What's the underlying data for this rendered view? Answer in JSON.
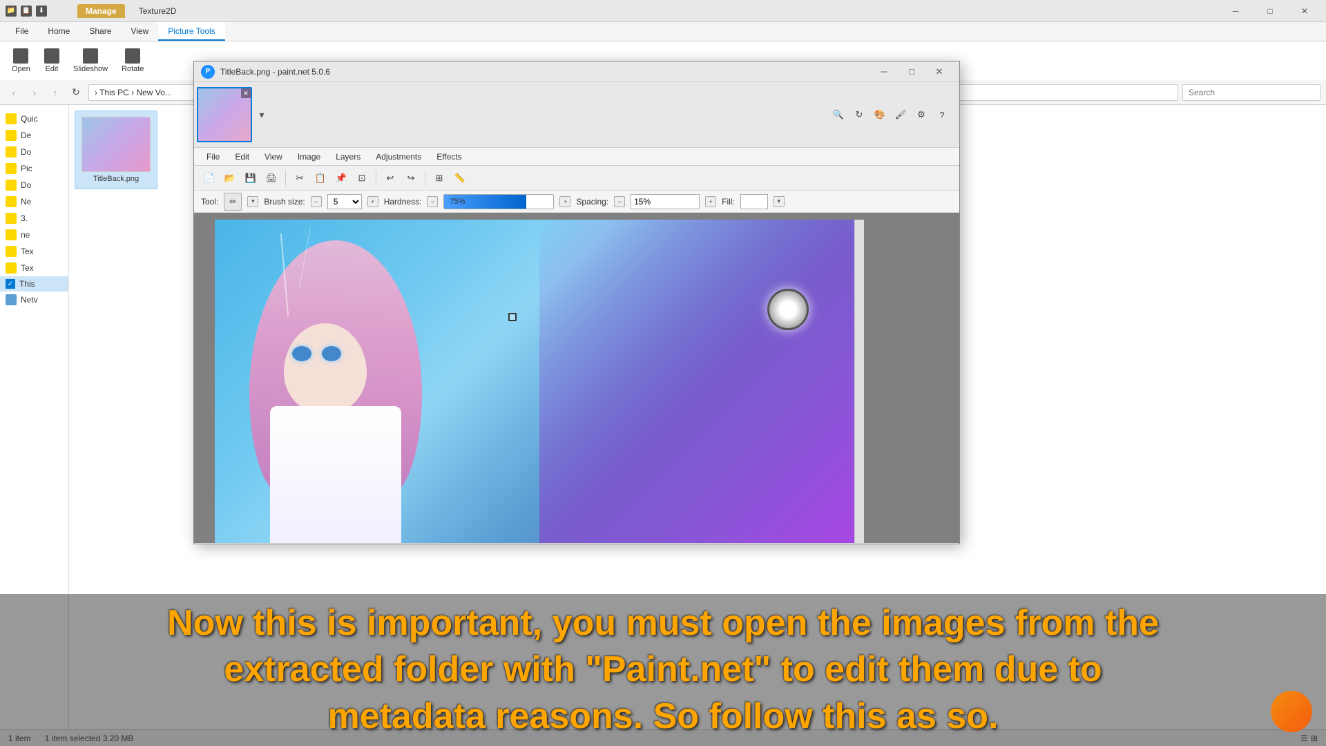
{
  "explorer": {
    "titlebar": {
      "quick_icons": [
        "📁",
        "📋",
        "⬇"
      ],
      "tab_manage": "Manage",
      "tab_texture": "Texture2D"
    },
    "ribbon": {
      "tabs": [
        "File",
        "Home",
        "Share",
        "View",
        "Picture Tools"
      ],
      "active_tab": "Picture Tools"
    },
    "address": {
      "path": "  ›  This PC  ›  New Vo...",
      "search_placeholder": "Search"
    },
    "sidebar_items": [
      {
        "label": "Quic",
        "type": "folder",
        "checked": false
      },
      {
        "label": "De",
        "type": "folder",
        "checked": false
      },
      {
        "label": "Do",
        "type": "folder",
        "checked": false
      },
      {
        "label": "Pic",
        "type": "folder",
        "checked": false
      },
      {
        "label": "Do",
        "type": "folder",
        "checked": false
      },
      {
        "label": "Ne",
        "type": "folder",
        "checked": false
      },
      {
        "label": "3.",
        "type": "folder",
        "checked": false
      },
      {
        "label": "ne",
        "type": "folder",
        "checked": false
      },
      {
        "label": "Tex",
        "type": "folder",
        "checked": false
      },
      {
        "label": "Tex",
        "type": "folder",
        "checked": false
      },
      {
        "label": "This",
        "type": "pc",
        "checked": true
      },
      {
        "label": "Netv",
        "type": "net",
        "checked": false
      }
    ],
    "file_item": {
      "name": "TitleBack.png",
      "selected": true
    },
    "status": {
      "count": "1 item",
      "selection": "1 item selected  3.20 MB"
    }
  },
  "paintnet": {
    "title": "TitleBack.png - paint.net 5.0.6",
    "menu_items": [
      "File",
      "Edit",
      "View",
      "Image",
      "Layers",
      "Adjustments",
      "Effects"
    ],
    "toolbar": {
      "tools": [
        "new",
        "open",
        "save",
        "print",
        "sep",
        "cut",
        "copy",
        "paste",
        "crop",
        "sep",
        "undo",
        "redo",
        "sep",
        "grid",
        "ruler"
      ]
    },
    "tool_options": {
      "tool_label": "Tool:",
      "brush_size_label": "Brush size:",
      "brush_size_value": "5",
      "brush_size_minus": "−",
      "brush_size_plus": "+",
      "hardness_label": "Hardness:",
      "hardness_value": "75%",
      "spacing_label": "Spacing:",
      "spacing_value": "15%",
      "fill_label": "Fill:"
    },
    "canvas": {
      "image_file": "TitleBack.png"
    }
  },
  "overlay": {
    "text_line1": "Now this is important, you must open the images from the",
    "text_line2": "extracted folder with \"Paint.net\" to edit them due to",
    "text_line3": "metadata reasons. So follow this as so."
  },
  "icons": {
    "minimize": "─",
    "maximize": "□",
    "close": "✕",
    "back": "‹",
    "forward": "›",
    "up": "↑",
    "pencil": "✏",
    "brush": "🖌",
    "dropdown": "▾"
  }
}
